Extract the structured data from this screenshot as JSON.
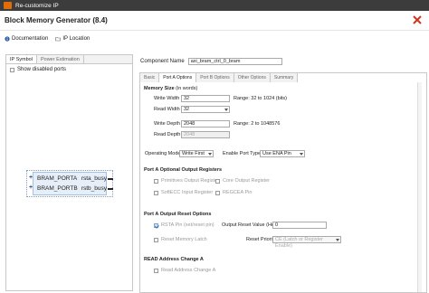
{
  "window": {
    "title": "Re-customize IP"
  },
  "header": {
    "title": "Block Memory Generator (8.4)"
  },
  "toolbar": {
    "documentation": "Documentation",
    "ip_location": "IP Location"
  },
  "left": {
    "tabs": [
      "IP Symbol",
      "Power Estimation"
    ],
    "show_disabled": "Show disabled ports",
    "ports": [
      {
        "name": "BRAM_PORTA",
        "busy": "rsta_busy"
      },
      {
        "name": "BRAM_PORTB",
        "busy": "rstb_busy"
      }
    ]
  },
  "right": {
    "component_name_label": "Component Name",
    "component_name_value": "axi_bram_ctrl_0_bram",
    "tabs": [
      "Basic",
      "Port A Options",
      "Port B Options",
      "Other Options",
      "Summary"
    ],
    "memory_size": {
      "title": "Memory Size",
      "title_note": "(in words)",
      "write_width_label": "Write Width",
      "write_width_value": "32",
      "write_width_range": "Range: 32 to 1024 (bits)",
      "read_width_label": "Read Width",
      "read_width_value": "32",
      "write_depth_label": "Write Depth",
      "write_depth_value": "2048",
      "write_depth_range": "Range: 2 to 1048576",
      "read_depth_label": "Read Depth",
      "read_depth_value": "2048"
    },
    "operating_mode_label": "Operating Mode",
    "operating_mode_value": "Write First",
    "enable_port_label": "Enable Port Type",
    "enable_port_value": "Use ENA Pin",
    "output_regs": {
      "title": "Port A Optional Output Registers",
      "primitives": "Primitives Output Register",
      "core": "Core Output Register",
      "softecc": "SoftECC Input Register",
      "regcea": "REGCEA Pin"
    },
    "output_reset": {
      "title": "Port A Output Reset Options",
      "rsta_pin": "RSTA Pin (set/reset pin)",
      "output_reset_value_label": "Output Reset Value (Hex)",
      "output_reset_value": "0",
      "reset_memory_latch": "Reset Memory Latch",
      "reset_priority_label": "Reset Priority",
      "reset_priority_value": "CE (Latch or Register Enable)"
    },
    "read_address": {
      "title": "READ Address Change A",
      "item": "Read Address Change A"
    }
  }
}
